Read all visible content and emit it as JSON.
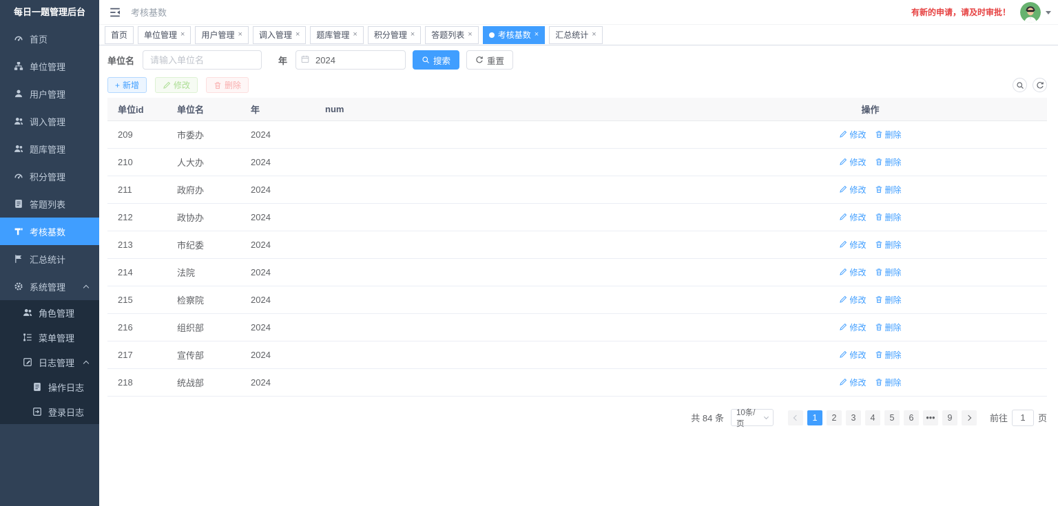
{
  "colors": {
    "primary": "#409eff",
    "sidebar_bg": "#304156",
    "submenu_bg": "#1f2d3d",
    "sidebar_text": "#bfcbd9",
    "danger": "#f56c6c",
    "notice_red": "#e64242",
    "table_header_bg": "#f8f8f9",
    "avatar_bg": "#67b26f"
  },
  "icons": {
    "close_glyph": "×",
    "plus_glyph": "+",
    "names": [
      "fold-icon",
      "dashboard-icon",
      "tree-icon",
      "user-icon",
      "peoples-icon",
      "doc-icon",
      "build-icon",
      "stats-icon",
      "gear-icon",
      "menu-tree-icon",
      "form-icon",
      "login-log-icon",
      "edit-icon",
      "trash-icon",
      "search-icon",
      "refresh-icon",
      "calendar-icon",
      "close-icon",
      "caret-down-icon",
      "chevron-icon"
    ]
  },
  "app": {
    "title": "每日一题管理后台"
  },
  "navbar": {
    "breadcrumb": "考核基数",
    "notice": "有新的申请，请及时审批！"
  },
  "sidebar": {
    "items": [
      {
        "label": "首页"
      },
      {
        "label": "单位管理"
      },
      {
        "label": "用户管理"
      },
      {
        "label": "调入管理"
      },
      {
        "label": "题库管理"
      },
      {
        "label": "积分管理"
      },
      {
        "label": "答题列表"
      },
      {
        "label": "考核基数",
        "active": true
      },
      {
        "label": "汇总统计"
      },
      {
        "label": "系统管理",
        "expanded": true
      }
    ],
    "system_children": [
      {
        "label": "角色管理"
      },
      {
        "label": "菜单管理"
      },
      {
        "label": "日志管理",
        "expanded": true
      }
    ],
    "log_children": [
      {
        "label": "操作日志"
      },
      {
        "label": "登录日志"
      }
    ]
  },
  "tabs": [
    {
      "label": "首页",
      "closable": false
    },
    {
      "label": "单位管理",
      "closable": true
    },
    {
      "label": "用户管理",
      "closable": true
    },
    {
      "label": "调入管理",
      "closable": true
    },
    {
      "label": "题库管理",
      "closable": true
    },
    {
      "label": "积分管理",
      "closable": true
    },
    {
      "label": "答题列表",
      "closable": true
    },
    {
      "label": "考核基数",
      "closable": true,
      "active": true
    },
    {
      "label": "汇总统计",
      "closable": true
    }
  ],
  "filter": {
    "unit_label": "单位名",
    "unit_placeholder": "请输入单位名",
    "year_label": "年",
    "year_value": "2024",
    "search_label": "搜索",
    "reset_label": "重置"
  },
  "toolbar": {
    "add_label": "新增",
    "edit_label": "修改",
    "delete_label": "删除"
  },
  "table": {
    "columns": [
      "单位id",
      "单位名",
      "年",
      "num",
      "操作"
    ],
    "edit_label": "修改",
    "delete_label": "删除",
    "rows": [
      {
        "id": "209",
        "name": "市委办",
        "year": "2024",
        "num": ""
      },
      {
        "id": "210",
        "name": "人大办",
        "year": "2024",
        "num": ""
      },
      {
        "id": "211",
        "name": "政府办",
        "year": "2024",
        "num": ""
      },
      {
        "id": "212",
        "name": "政协办",
        "year": "2024",
        "num": ""
      },
      {
        "id": "213",
        "name": "市纪委",
        "year": "2024",
        "num": ""
      },
      {
        "id": "214",
        "name": "法院",
        "year": "2024",
        "num": ""
      },
      {
        "id": "215",
        "name": "检察院",
        "year": "2024",
        "num": ""
      },
      {
        "id": "216",
        "name": "组织部",
        "year": "2024",
        "num": ""
      },
      {
        "id": "217",
        "name": "宣传部",
        "year": "2024",
        "num": ""
      },
      {
        "id": "218",
        "name": "统战部",
        "year": "2024",
        "num": ""
      }
    ]
  },
  "pagination": {
    "total_label": "共 84 条",
    "page_size": "10条/页",
    "pages": [
      "1",
      "2",
      "3",
      "4",
      "5",
      "6",
      "•••",
      "9"
    ],
    "active_page": "1",
    "goto_label": "前往",
    "goto_value": "1",
    "goto_unit": "页"
  }
}
